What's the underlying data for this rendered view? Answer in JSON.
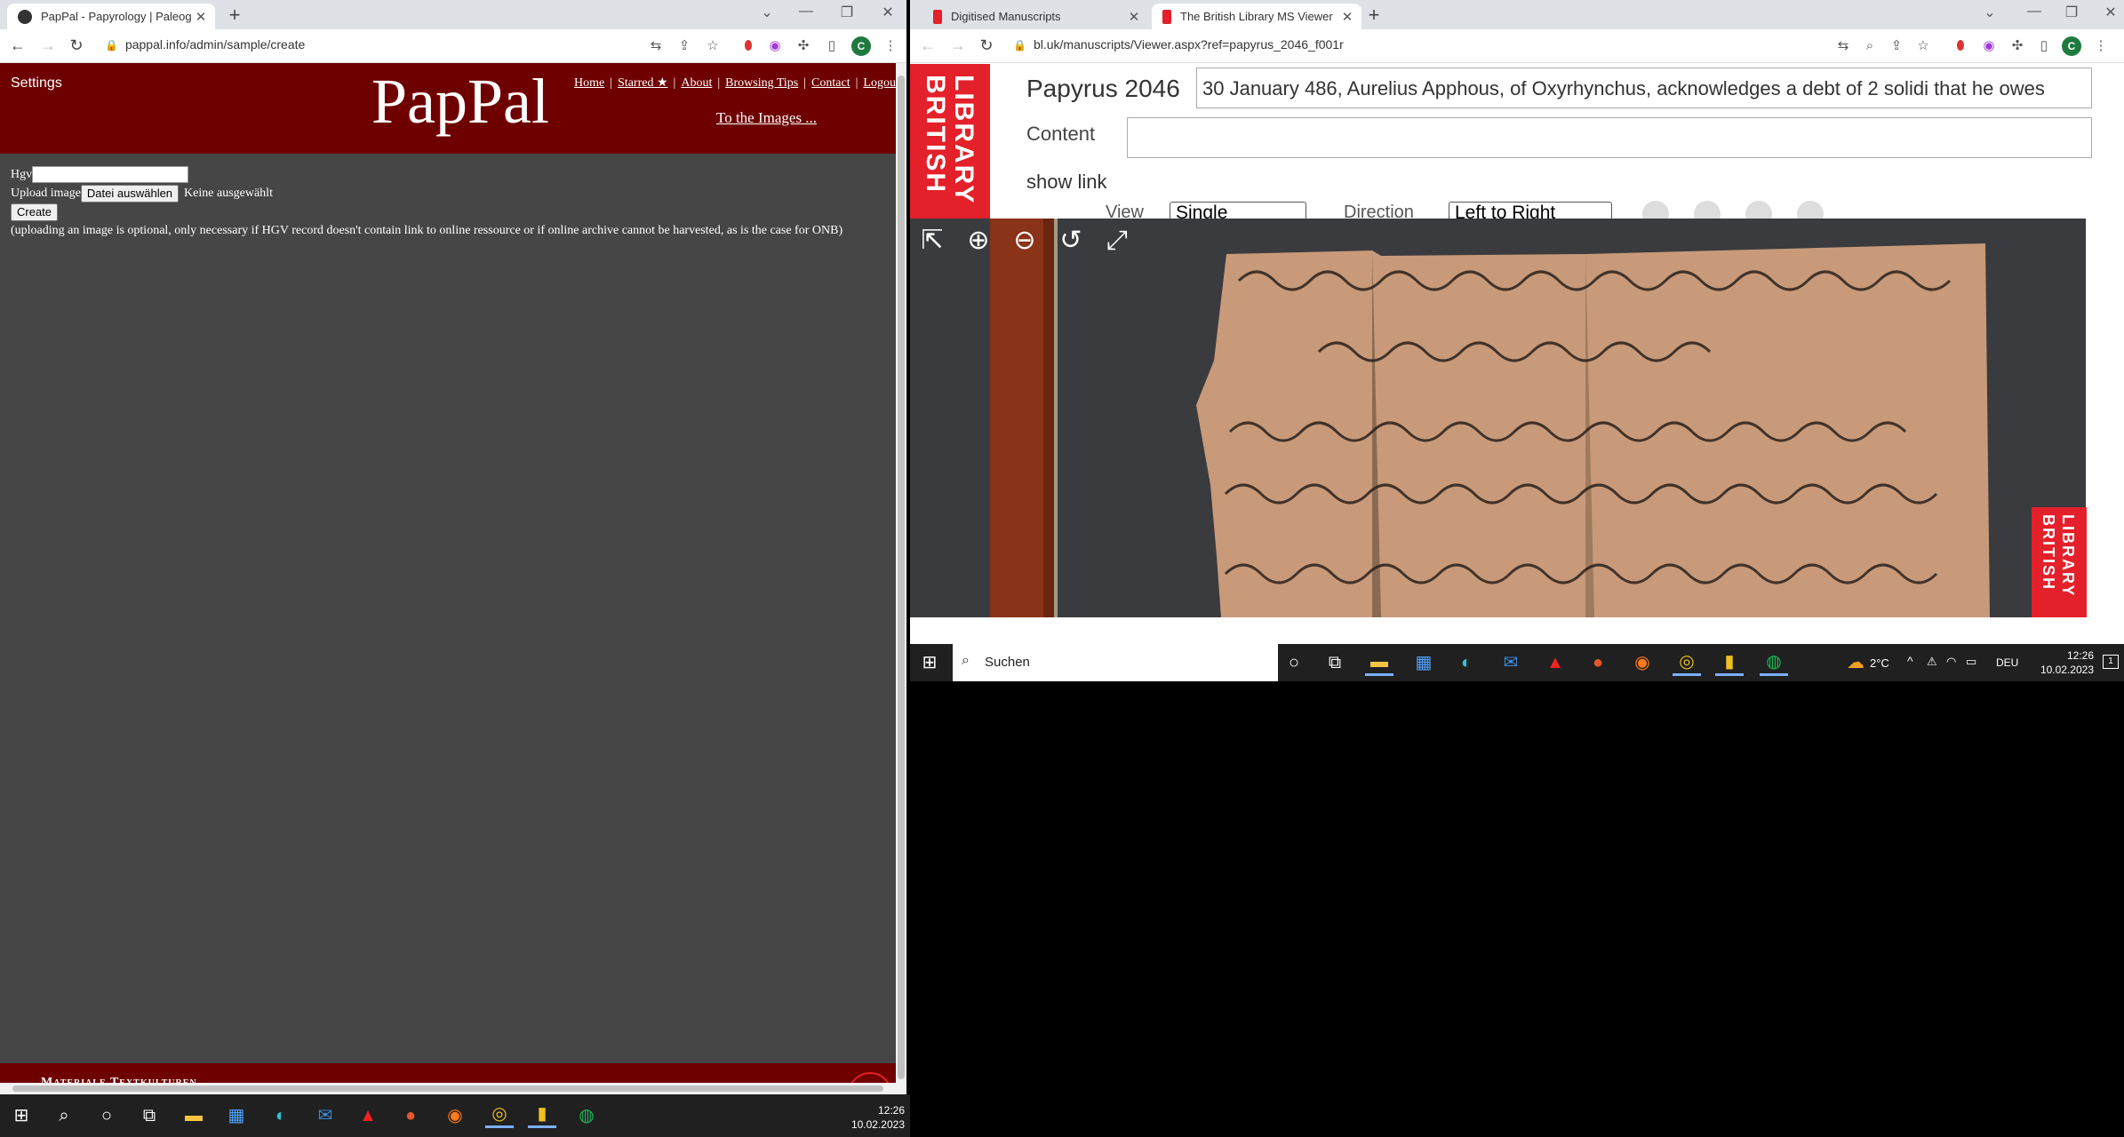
{
  "left_window": {
    "tab_title": "PapPal - Papyrology | Paleograph",
    "url": "pappal.info/admin/sample/create",
    "pappal": {
      "settings": "Settings",
      "logo": "PapPal",
      "nav": [
        "Home",
        "Starred ★",
        "About",
        "Browsing Tips",
        "Contact",
        "Logou"
      ],
      "to_images": "To the Images ...",
      "form": {
        "hgv_label": "Hgv",
        "hgv_value": "",
        "upload_label": "Upload image",
        "choose_file": "Datei auswählen",
        "no_file": "Keine ausgewählt",
        "create": "Create",
        "note": "(uploading an image is optional, only necessary if HGV record doesn't contain link to online ressource or if online archive cannot be harvested, as is the case for ONB)"
      },
      "footer": "Materiale Textkulturen"
    }
  },
  "right_window": {
    "tabs": [
      "Digitised Manuscripts",
      "The British Library MS Viewer"
    ],
    "url": "bl.uk/manuscripts/Viewer.aspx?ref=papyrus_2046_f001r",
    "logo_lines": [
      "BRITISH",
      "LIBRARY"
    ],
    "title": "Papyrus 2046",
    "description": "30 January 486, Aurelius Apphous, of Oxyrhynchus, acknowledges a debt of 2 solidi that he owes",
    "content_label": "Content",
    "content_value": "",
    "show_link": "show link",
    "view_label": "View",
    "view_value": "Single",
    "direction_label": "Direction",
    "direction_value": "Left to Right"
  },
  "taskbar": {
    "search_placeholder": "Suchen",
    "temperature": "2°C",
    "language": "DEU",
    "time": "12:26",
    "date": "10.02.2023",
    "notification_count": "1"
  },
  "colors": {
    "pappal_red": "#6f0000",
    "bl_red": "#e4202a",
    "papyrus": "#c89a79"
  }
}
